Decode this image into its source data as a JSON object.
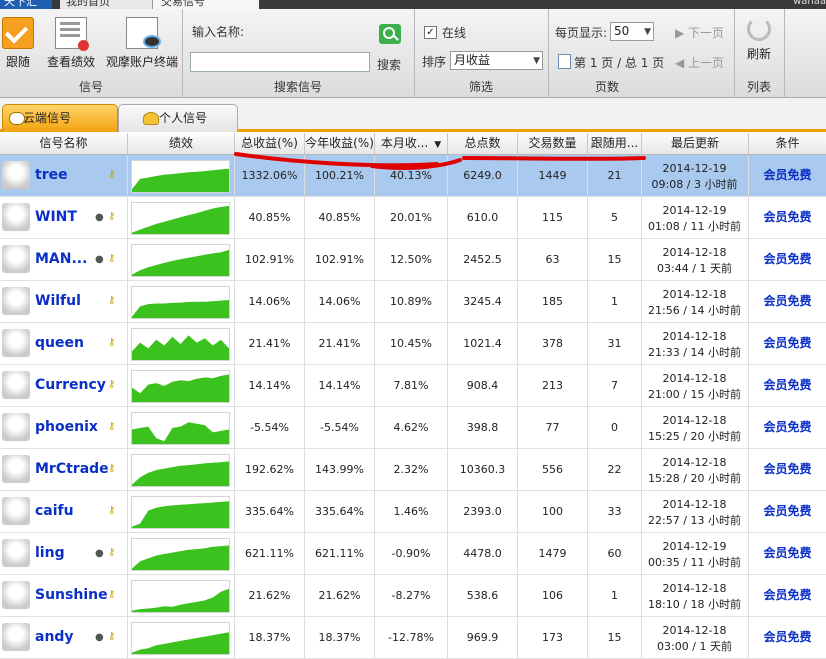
{
  "top_tabs": [
    "天下汇",
    "我的首页",
    "交易信号"
  ],
  "top_right": "wanaa",
  "ribbon": {
    "follow_label": "跟随",
    "view_perf_label": "查看绩效",
    "watch_label": "观摩账户终端",
    "group_signal": "信号",
    "input_name_label": "输入名称:",
    "search_input_value": "",
    "search_label": "搜索",
    "group_search": "搜索信号",
    "online_label": "在线",
    "online_checked": true,
    "sort_label": "排序",
    "sort_value": "月收益",
    "group_filter": "筛选",
    "per_page_label": "每页显示:",
    "per_page_value": "50",
    "page_info": "第 1 页 / 总 1 页",
    "next_label": "下一页",
    "prev_label": "上一页",
    "group_pages": "页数",
    "refresh_label": "刷新",
    "group_list": "列表"
  },
  "signal_tabs": {
    "cloud": "云端信号",
    "personal": "个人信号"
  },
  "columns": {
    "name": "信号名称",
    "perf": "绩效",
    "total": "总收益(%)",
    "year": "今年收益(%)",
    "month": "本月收...",
    "points": "总点数",
    "trades": "交易数量",
    "followers": "跟随用...",
    "updated": "最后更新",
    "cond": "条件"
  },
  "rows": [
    {
      "name": "tree",
      "eye": false,
      "total": "1332.06%",
      "year": "100.21%",
      "month": "40.13%",
      "points": "6249.0",
      "trades": "1449",
      "followers": "21",
      "date": "2014-12-19",
      "time": "09:08 / 3 小时前",
      "cond": "会员免费",
      "selected": true,
      "spark": "[0.1,0.45,0.5,0.55,0.6,0.62,0.65,0.68,0.7,0.72,0.75,0.78,0.8]"
    },
    {
      "name": "WINT",
      "eye": true,
      "total": "40.85%",
      "year": "40.85%",
      "month": "20.01%",
      "points": "610.0",
      "trades": "115",
      "followers": "5",
      "date": "2014-12-19",
      "time": "01:08 / 11 小时前",
      "cond": "会员免费",
      "spark": "[0.05,0.15,0.25,0.35,0.42,0.5,0.58,0.65,0.72,0.8,0.88,0.93,0.97]"
    },
    {
      "name": "MAN...",
      "eye": true,
      "total": "102.91%",
      "year": "102.91%",
      "month": "12.50%",
      "points": "2452.5",
      "trades": "63",
      "followers": "15",
      "date": "2014-12-18",
      "time": "03:44 / 1 天前",
      "cond": "会员免费",
      "spark": "[0.05,0.2,0.3,0.38,0.45,0.52,0.58,0.63,0.68,0.73,0.78,0.82,0.9]"
    },
    {
      "name": "Wilful",
      "eye": false,
      "total": "14.06%",
      "year": "14.06%",
      "month": "10.89%",
      "points": "3245.4",
      "trades": "185",
      "followers": "1",
      "date": "2014-12-18",
      "time": "21:56 / 14 小时前",
      "cond": "会员免费",
      "spark": "[0.05,0.4,0.48,0.5,0.5,0.52,0.53,0.55,0.56,0.56,0.58,0.6,0.62]"
    },
    {
      "name": "queen",
      "eye": false,
      "total": "21.41%",
      "year": "21.41%",
      "month": "10.45%",
      "points": "1021.4",
      "trades": "378",
      "followers": "31",
      "date": "2014-12-18",
      "time": "21:33 / 14 小时前",
      "cond": "会员免费",
      "spark": "[0.3,0.6,0.4,0.7,0.5,0.8,0.55,0.85,0.6,0.75,0.5,0.7,0.4]"
    },
    {
      "name": "Currency",
      "eye": false,
      "total": "14.14%",
      "year": "14.14%",
      "month": "7.81%",
      "points": "908.4",
      "trades": "213",
      "followers": "7",
      "date": "2014-12-18",
      "time": "21:00 / 15 小时前",
      "cond": "会员免费",
      "spark": "[0.5,0.3,0.6,0.65,0.55,0.7,0.75,0.72,0.8,0.85,0.82,0.9,0.95]"
    },
    {
      "name": "phoenix",
      "eye": false,
      "total": "-5.54%",
      "year": "-5.54%",
      "month": "4.62%",
      "points": "398.8",
      "trades": "77",
      "followers": "0",
      "date": "2014-12-18",
      "time": "15:25 / 20 小时前",
      "cond": "会员免费",
      "spark": "[0.5,0.55,0.6,0.2,0.1,0.55,0.6,0.75,0.7,0.65,0.4,0.45,0.5]"
    },
    {
      "name": "MrCtrade",
      "eye": false,
      "total": "192.62%",
      "year": "143.99%",
      "month": "2.32%",
      "points": "10360.3",
      "trades": "556",
      "followers": "22",
      "date": "2014-12-18",
      "time": "15:28 / 20 小时前",
      "cond": "会员免费",
      "spark": "[0.05,0.3,0.45,0.55,0.6,0.65,0.7,0.72,0.75,0.78,0.8,0.82,0.85]"
    },
    {
      "name": "caifu",
      "eye": false,
      "total": "335.64%",
      "year": "335.64%",
      "month": "1.46%",
      "points": "2393.0",
      "trades": "100",
      "followers": "33",
      "date": "2014-12-18",
      "time": "22:57 / 13 小时前",
      "cond": "会员免费",
      "spark": "[0.05,0.15,0.6,0.7,0.75,0.78,0.8,0.82,0.84,0.86,0.88,0.9,0.92]"
    },
    {
      "name": "ling",
      "eye": true,
      "total": "621.11%",
      "year": "621.11%",
      "month": "-0.90%",
      "points": "4478.0",
      "trades": "1479",
      "followers": "60",
      "date": "2014-12-19",
      "time": "00:35 / 11 小时前",
      "cond": "会员免费",
      "spark": "[0.05,0.3,0.4,0.5,0.55,0.6,0.65,0.7,0.72,0.75,0.8,0.82,0.85]"
    },
    {
      "name": "Sunshine",
      "eye": false,
      "total": "21.62%",
      "year": "21.62%",
      "month": "-8.27%",
      "points": "538.6",
      "trades": "106",
      "followers": "1",
      "date": "2014-12-18",
      "time": "18:10 / 18 小时前",
      "cond": "会员免费",
      "spark": "[0.05,0.1,0.12,0.15,0.2,0.18,0.25,0.3,0.35,0.4,0.5,0.7,0.8]"
    },
    {
      "name": "andy",
      "eye": true,
      "total": "18.37%",
      "year": "18.37%",
      "month": "-12.78%",
      "points": "969.9",
      "trades": "173",
      "followers": "15",
      "date": "2014-12-18",
      "time": "03:00 / 1 天前",
      "cond": "会员免费",
      "spark": "[0.05,0.15,0.2,0.3,0.35,0.4,0.45,0.5,0.55,0.6,0.65,0.7,0.75]"
    }
  ],
  "colors": {
    "accent": "#f0a000",
    "link": "#0a2fc8",
    "spark": "#3cc21e",
    "annotation": "#e00000",
    "selected": "#a9c9ee"
  }
}
